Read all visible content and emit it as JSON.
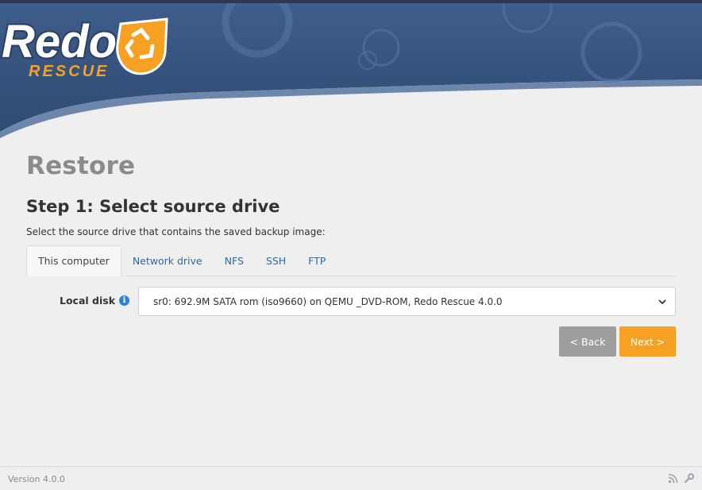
{
  "colors": {
    "header_blue": "#365480",
    "accent_orange": "#f6a024",
    "back_gray": "#9e9e9e",
    "link_blue": "#3a6597",
    "info_blue": "#2f7fdc"
  },
  "header": {
    "logo_text": "Redo",
    "logo_subtext": "RESCUE",
    "logo_icon": "recycle-icon"
  },
  "page": {
    "title": "Restore",
    "step_title": "Step 1: Select source drive",
    "step_description": "Select the source drive that contains the saved backup image:"
  },
  "tabs": [
    {
      "label": "This computer",
      "active": true
    },
    {
      "label": "Network drive",
      "active": false
    },
    {
      "label": "NFS",
      "active": false
    },
    {
      "label": "SSH",
      "active": false
    },
    {
      "label": "FTP",
      "active": false
    }
  ],
  "local_disk": {
    "label": "Local disk",
    "info_icon": "info-icon",
    "selected_value": "sr0: 692.9M SATA rom (iso9660) on QEMU _DVD-ROM, Redo Rescue 4.0.0"
  },
  "buttons": {
    "back": "< Back",
    "next": "Next >"
  },
  "footer": {
    "version": "Version 4.0.0",
    "icons": [
      "rss-icon",
      "wrench-icon"
    ]
  }
}
